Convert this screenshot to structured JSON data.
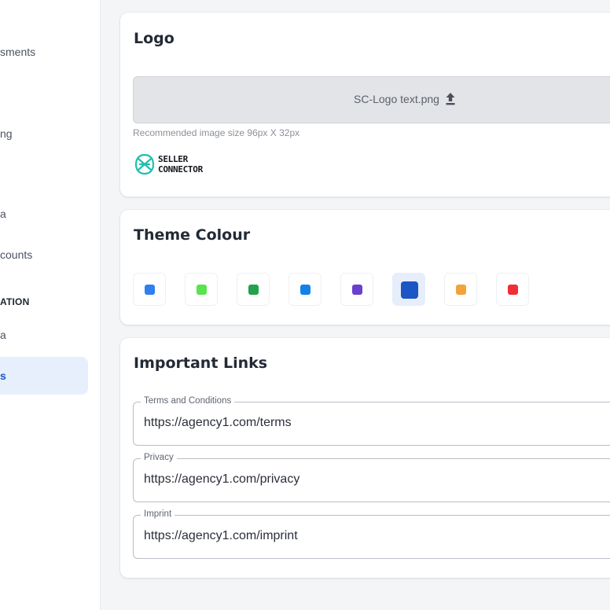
{
  "sidebar": {
    "items": [
      {
        "label": "sments"
      },
      {
        "label": "ng"
      },
      {
        "label": "a"
      },
      {
        "label": "counts"
      }
    ],
    "section_label": "ATION",
    "items_after": [
      {
        "label": "a"
      }
    ],
    "active_item": {
      "label": "s"
    }
  },
  "logo_card": {
    "title": "Logo",
    "upload": {
      "filename": "SC-Logo text.png",
      "icon": "upload-icon"
    },
    "hint": "Recommended image size 96px X 32px",
    "brand": {
      "line1": "SELLER",
      "line2": "CONNECTOR",
      "icon": "seller-connector-logo-icon"
    }
  },
  "theme_card": {
    "title": "Theme Colour",
    "swatches": [
      {
        "color": "#2f7ff0",
        "selected": false
      },
      {
        "color": "#59e34d",
        "selected": false
      },
      {
        "color": "#22a24a",
        "selected": false
      },
      {
        "color": "#1282e8",
        "selected": false
      },
      {
        "color": "#6b3fd0",
        "selected": false
      },
      {
        "color": "#1c55c4",
        "selected": true
      },
      {
        "color": "#f4a23c",
        "selected": false
      },
      {
        "color": "#ef2f35",
        "selected": false
      }
    ]
  },
  "links_card": {
    "title": "Important Links",
    "fields": [
      {
        "label": "Terms and Conditions",
        "value": "https://agency1.com/terms"
      },
      {
        "label": "Privacy",
        "value": "https://agency1.com/privacy"
      },
      {
        "label": "Imprint",
        "value": "https://agency1.com/imprint"
      }
    ]
  }
}
